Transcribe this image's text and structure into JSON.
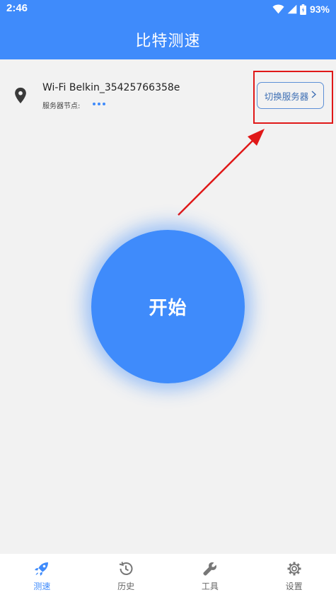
{
  "status_bar": {
    "time": "2:46",
    "battery": "93%",
    "icons": [
      "wifi-icon",
      "signal-icon",
      "battery-icon"
    ]
  },
  "header": {
    "title": "比特测速"
  },
  "network": {
    "ssid": "Wi-Fi Belkin_35425766358e",
    "node_label": "服务器节点:",
    "node_value_icon": "loading-dots-icon"
  },
  "switch_server": {
    "label": "切换服务器",
    "icon": "chevron-right-icon"
  },
  "start": {
    "label": "开始"
  },
  "bottom_nav": {
    "items": [
      {
        "label": "测速",
        "icon": "rocket-icon",
        "active": true
      },
      {
        "label": "历史",
        "icon": "history-icon",
        "active": false
      },
      {
        "label": "工具",
        "icon": "wrench-icon",
        "active": false
      },
      {
        "label": "设置",
        "icon": "gear-icon",
        "active": false
      }
    ]
  },
  "colors": {
    "primary": "#3f8bfb",
    "annotation_red": "#e01818",
    "background": "#f2f2f2"
  }
}
